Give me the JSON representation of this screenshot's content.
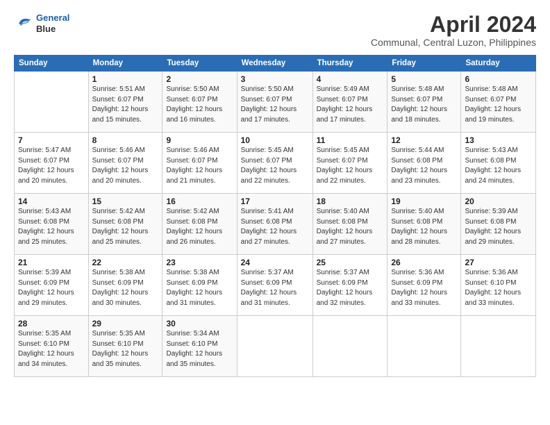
{
  "header": {
    "logo_line1": "General",
    "logo_line2": "Blue",
    "month": "April 2024",
    "location": "Communal, Central Luzon, Philippines"
  },
  "weekdays": [
    "Sunday",
    "Monday",
    "Tuesday",
    "Wednesday",
    "Thursday",
    "Friday",
    "Saturday"
  ],
  "weeks": [
    [
      {
        "day": "",
        "sunrise": "",
        "sunset": "",
        "daylight": ""
      },
      {
        "day": "1",
        "sunrise": "Sunrise: 5:51 AM",
        "sunset": "Sunset: 6:07 PM",
        "daylight": "Daylight: 12 hours and 15 minutes."
      },
      {
        "day": "2",
        "sunrise": "Sunrise: 5:50 AM",
        "sunset": "Sunset: 6:07 PM",
        "daylight": "Daylight: 12 hours and 16 minutes."
      },
      {
        "day": "3",
        "sunrise": "Sunrise: 5:50 AM",
        "sunset": "Sunset: 6:07 PM",
        "daylight": "Daylight: 12 hours and 17 minutes."
      },
      {
        "day": "4",
        "sunrise": "Sunrise: 5:49 AM",
        "sunset": "Sunset: 6:07 PM",
        "daylight": "Daylight: 12 hours and 17 minutes."
      },
      {
        "day": "5",
        "sunrise": "Sunrise: 5:48 AM",
        "sunset": "Sunset: 6:07 PM",
        "daylight": "Daylight: 12 hours and 18 minutes."
      },
      {
        "day": "6",
        "sunrise": "Sunrise: 5:48 AM",
        "sunset": "Sunset: 6:07 PM",
        "daylight": "Daylight: 12 hours and 19 minutes."
      }
    ],
    [
      {
        "day": "7",
        "sunrise": "Sunrise: 5:47 AM",
        "sunset": "Sunset: 6:07 PM",
        "daylight": "Daylight: 12 hours and 20 minutes."
      },
      {
        "day": "8",
        "sunrise": "Sunrise: 5:46 AM",
        "sunset": "Sunset: 6:07 PM",
        "daylight": "Daylight: 12 hours and 20 minutes."
      },
      {
        "day": "9",
        "sunrise": "Sunrise: 5:46 AM",
        "sunset": "Sunset: 6:07 PM",
        "daylight": "Daylight: 12 hours and 21 minutes."
      },
      {
        "day": "10",
        "sunrise": "Sunrise: 5:45 AM",
        "sunset": "Sunset: 6:07 PM",
        "daylight": "Daylight: 12 hours and 22 minutes."
      },
      {
        "day": "11",
        "sunrise": "Sunrise: 5:45 AM",
        "sunset": "Sunset: 6:07 PM",
        "daylight": "Daylight: 12 hours and 22 minutes."
      },
      {
        "day": "12",
        "sunrise": "Sunrise: 5:44 AM",
        "sunset": "Sunset: 6:08 PM",
        "daylight": "Daylight: 12 hours and 23 minutes."
      },
      {
        "day": "13",
        "sunrise": "Sunrise: 5:43 AM",
        "sunset": "Sunset: 6:08 PM",
        "daylight": "Daylight: 12 hours and 24 minutes."
      }
    ],
    [
      {
        "day": "14",
        "sunrise": "Sunrise: 5:43 AM",
        "sunset": "Sunset: 6:08 PM",
        "daylight": "Daylight: 12 hours and 25 minutes."
      },
      {
        "day": "15",
        "sunrise": "Sunrise: 5:42 AM",
        "sunset": "Sunset: 6:08 PM",
        "daylight": "Daylight: 12 hours and 25 minutes."
      },
      {
        "day": "16",
        "sunrise": "Sunrise: 5:42 AM",
        "sunset": "Sunset: 6:08 PM",
        "daylight": "Daylight: 12 hours and 26 minutes."
      },
      {
        "day": "17",
        "sunrise": "Sunrise: 5:41 AM",
        "sunset": "Sunset: 6:08 PM",
        "daylight": "Daylight: 12 hours and 27 minutes."
      },
      {
        "day": "18",
        "sunrise": "Sunrise: 5:40 AM",
        "sunset": "Sunset: 6:08 PM",
        "daylight": "Daylight: 12 hours and 27 minutes."
      },
      {
        "day": "19",
        "sunrise": "Sunrise: 5:40 AM",
        "sunset": "Sunset: 6:08 PM",
        "daylight": "Daylight: 12 hours and 28 minutes."
      },
      {
        "day": "20",
        "sunrise": "Sunrise: 5:39 AM",
        "sunset": "Sunset: 6:08 PM",
        "daylight": "Daylight: 12 hours and 29 minutes."
      }
    ],
    [
      {
        "day": "21",
        "sunrise": "Sunrise: 5:39 AM",
        "sunset": "Sunset: 6:09 PM",
        "daylight": "Daylight: 12 hours and 29 minutes."
      },
      {
        "day": "22",
        "sunrise": "Sunrise: 5:38 AM",
        "sunset": "Sunset: 6:09 PM",
        "daylight": "Daylight: 12 hours and 30 minutes."
      },
      {
        "day": "23",
        "sunrise": "Sunrise: 5:38 AM",
        "sunset": "Sunset: 6:09 PM",
        "daylight": "Daylight: 12 hours and 31 minutes."
      },
      {
        "day": "24",
        "sunrise": "Sunrise: 5:37 AM",
        "sunset": "Sunset: 6:09 PM",
        "daylight": "Daylight: 12 hours and 31 minutes."
      },
      {
        "day": "25",
        "sunrise": "Sunrise: 5:37 AM",
        "sunset": "Sunset: 6:09 PM",
        "daylight": "Daylight: 12 hours and 32 minutes."
      },
      {
        "day": "26",
        "sunrise": "Sunrise: 5:36 AM",
        "sunset": "Sunset: 6:09 PM",
        "daylight": "Daylight: 12 hours and 33 minutes."
      },
      {
        "day": "27",
        "sunrise": "Sunrise: 5:36 AM",
        "sunset": "Sunset: 6:10 PM",
        "daylight": "Daylight: 12 hours and 33 minutes."
      }
    ],
    [
      {
        "day": "28",
        "sunrise": "Sunrise: 5:35 AM",
        "sunset": "Sunset: 6:10 PM",
        "daylight": "Daylight: 12 hours and 34 minutes."
      },
      {
        "day": "29",
        "sunrise": "Sunrise: 5:35 AM",
        "sunset": "Sunset: 6:10 PM",
        "daylight": "Daylight: 12 hours and 35 minutes."
      },
      {
        "day": "30",
        "sunrise": "Sunrise: 5:34 AM",
        "sunset": "Sunset: 6:10 PM",
        "daylight": "Daylight: 12 hours and 35 minutes."
      },
      {
        "day": "",
        "sunrise": "",
        "sunset": "",
        "daylight": ""
      },
      {
        "day": "",
        "sunrise": "",
        "sunset": "",
        "daylight": ""
      },
      {
        "day": "",
        "sunrise": "",
        "sunset": "",
        "daylight": ""
      },
      {
        "day": "",
        "sunrise": "",
        "sunset": "",
        "daylight": ""
      }
    ]
  ]
}
